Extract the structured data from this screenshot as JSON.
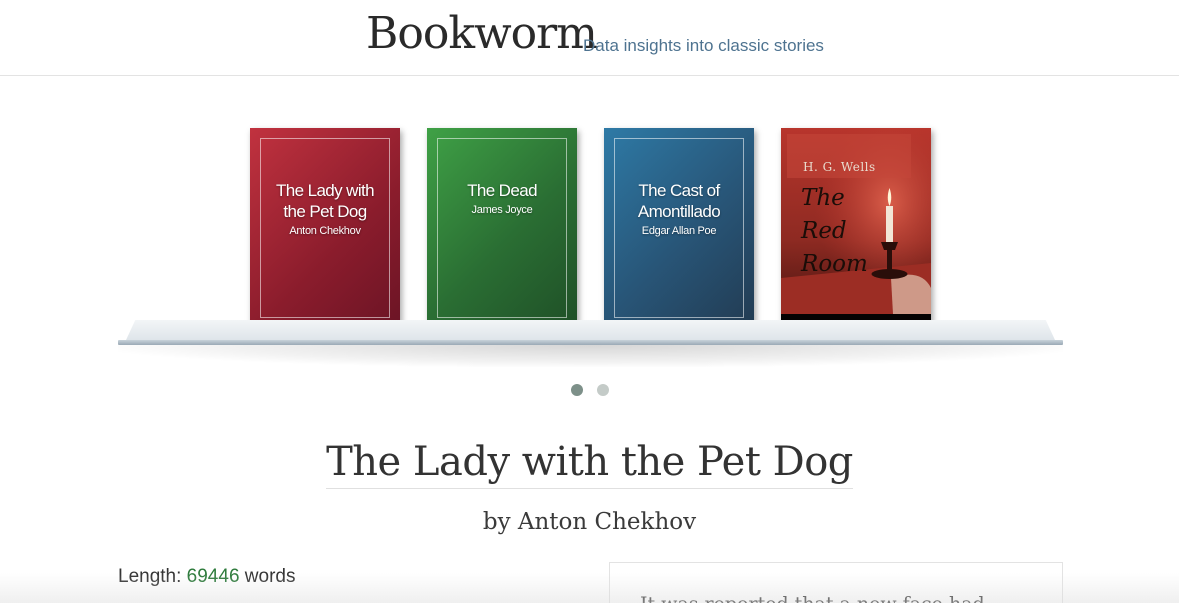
{
  "header": {
    "brand": "Bookworm",
    "tagline": "Data insights into classic stories"
  },
  "shelf": {
    "books": [
      {
        "title_line1": "The Lady with",
        "title_line2": "the Pet Dog",
        "author": "Anton Chekhov",
        "color": "#a3263a"
      },
      {
        "title_line1": "The Dead",
        "author": "James Joyce",
        "color": "#318a3c"
      },
      {
        "title_line1": "The Cast of",
        "title_line2": "Amontillado",
        "author": "Edgar Allan Poe",
        "color": "#2a6389"
      },
      {
        "cover_author": "H. G. Wells",
        "cover_title_1": "The",
        "cover_title_2": "Red",
        "cover_title_3": "Room",
        "color": "#b8322a"
      }
    ],
    "pagination": {
      "pages": 2,
      "active": 1
    }
  },
  "story": {
    "title": "The Lady with the Pet Dog",
    "byline": "by Anton Chekhov",
    "length_label": "Length: ",
    "length_value": "69446",
    "length_unit": " words",
    "panel_text": "It was reported that a new face had"
  }
}
